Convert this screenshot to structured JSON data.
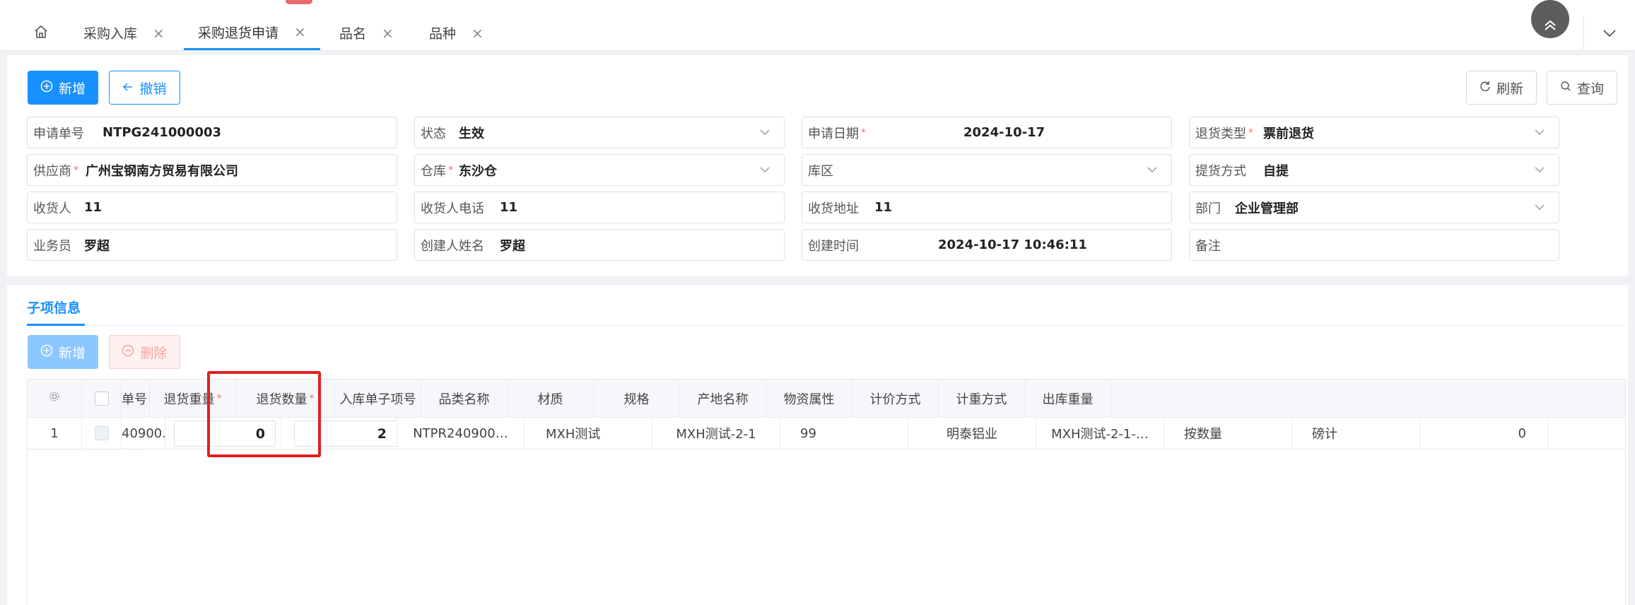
{
  "tabs": [
    {
      "label": "采购入库",
      "active": false
    },
    {
      "label": "采购退货申请",
      "active": true
    },
    {
      "label": "品名",
      "active": false
    },
    {
      "label": "品种",
      "active": false
    }
  ],
  "toolbar": {
    "add_label": "新增",
    "revoke_label": "撤销",
    "refresh_label": "刷新",
    "query_label": "查询"
  },
  "form": {
    "apply_no": {
      "label": "申请单号",
      "value": "NTPG241000003"
    },
    "status": {
      "label": "状态",
      "value": "生效"
    },
    "apply_date": {
      "label": "申请日期",
      "value": "2024-10-17"
    },
    "return_type": {
      "label": "退货类型",
      "value": "票前退货"
    },
    "supplier": {
      "label": "供应商",
      "value": "广州宝钢南方贸易有限公司"
    },
    "warehouse": {
      "label": "仓库",
      "value": "东沙仓"
    },
    "area": {
      "label": "库区",
      "value": ""
    },
    "pickup": {
      "label": "提货方式",
      "value": "自提"
    },
    "receiver": {
      "label": "收货人",
      "value": "11"
    },
    "receiver_phone": {
      "label": "收货人电话",
      "value": "11"
    },
    "receiver_addr": {
      "label": "收货地址",
      "value": "11"
    },
    "dept": {
      "label": "部门",
      "value": "企业管理部"
    },
    "salesman": {
      "label": "业务员",
      "value": "罗超"
    },
    "creator": {
      "label": "创建人姓名",
      "value": "罗超"
    },
    "created_at": {
      "label": "创建时间",
      "value": "2024-10-17 10:46:11"
    },
    "remark": {
      "label": "备注",
      "value": ""
    }
  },
  "child": {
    "title": "子项信息",
    "add_label": "新增",
    "delete_label": "删除",
    "columns": {
      "partial_no": "单号",
      "return_weight": "退货重量",
      "return_qty": "退货数量",
      "in_item_no": "入库单子项号",
      "category": "品类名称",
      "material": "材质",
      "spec": "规格",
      "origin": "产地名称",
      "attr": "物资属性",
      "pricing": "计价方式",
      "weighing": "计重方式",
      "out_weight": "出库重量"
    },
    "rows": [
      {
        "index": "1",
        "partial_no": "40900…",
        "return_weight": "0",
        "return_qty": "2",
        "in_item_no": "NTPR240900…",
        "category": "MXH测试",
        "material": "MXH测试-2-1",
        "spec": "99",
        "origin": "明泰铝业",
        "attr": "MXH测试-2-1-…",
        "pricing": "按数量",
        "weighing": "磅计",
        "out_weight": "0"
      }
    ]
  },
  "colors": {
    "primary": "#1890ff",
    "required": "#f56c6c",
    "highlight": "#e02020"
  }
}
